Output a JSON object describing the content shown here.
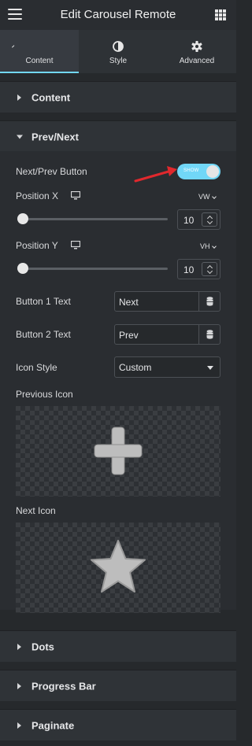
{
  "topbar": {
    "title": "Edit Carousel Remote"
  },
  "tabs": [
    {
      "label": "Content",
      "icon": "pencil-icon",
      "active": true
    },
    {
      "label": "Style",
      "icon": "half-circle-icon",
      "active": false
    },
    {
      "label": "Advanced",
      "icon": "gear-icon",
      "active": false
    }
  ],
  "sections": {
    "content": "Content",
    "prev_next": "Prev/Next",
    "dots": "Dots",
    "progress_bar": "Progress Bar",
    "paginate": "Paginate"
  },
  "controls": {
    "next_prev_button": {
      "label": "Next/Prev Button",
      "state": "SHOW",
      "enabled": true
    },
    "position_x": {
      "label": "Position X",
      "unit": "VW",
      "value": "10",
      "slider_fraction": 0
    },
    "position_y": {
      "label": "Position Y",
      "unit": "VH",
      "value": "10",
      "slider_fraction": 0
    },
    "button_1_text": {
      "label": "Button 1 Text",
      "value": "Next"
    },
    "button_2_text": {
      "label": "Button 2 Text",
      "value": "Prev"
    },
    "icon_style": {
      "label": "Icon Style",
      "value": "Custom"
    },
    "previous_icon": {
      "label": "Previous Icon",
      "icon": "plus-icon"
    },
    "next_icon": {
      "label": "Next Icon",
      "icon": "star-icon"
    }
  },
  "colors": {
    "accent": "#71d7f7",
    "annotation_arrow": "#e0282d",
    "panel_bg": "#2a2d31"
  }
}
